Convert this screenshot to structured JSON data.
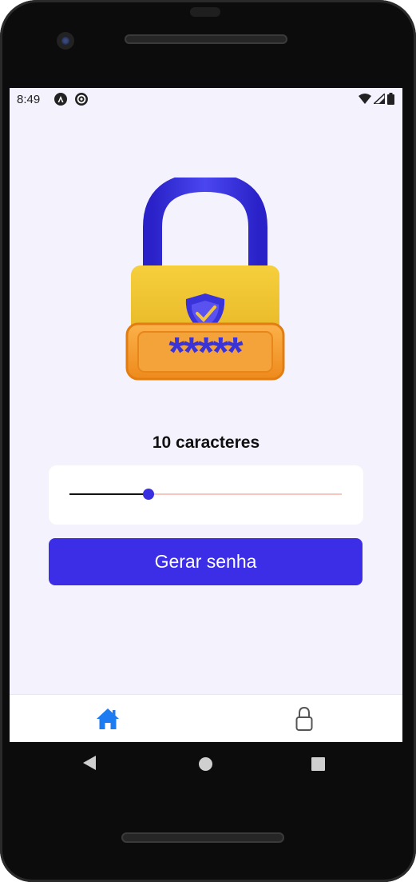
{
  "status_bar": {
    "time": "8:49",
    "icons": [
      "a-circle-icon",
      "at-circle-icon",
      "wifi-icon",
      "signal-icon",
      "battery-icon"
    ]
  },
  "hero": {
    "icon": "padlock-password-icon",
    "password_mask": "*****",
    "colors": {
      "shackle": "#3a33d9",
      "body": "#f2c230",
      "field": "#f39a2a",
      "shield": "#3a33d9"
    }
  },
  "main": {
    "char_label": "10 caracteres",
    "slider": {
      "value": 10,
      "fill_fraction": 0.29
    },
    "generate_button_label": "Gerar senha"
  },
  "tab_bar": {
    "tabs": [
      {
        "icon": "home-icon",
        "active": true,
        "color": "#1e7cf2"
      },
      {
        "icon": "lock-icon",
        "active": false,
        "color": "#555555"
      }
    ]
  },
  "nav_bar": {
    "icons": [
      "back-icon",
      "home-circle-icon",
      "recents-icon"
    ]
  },
  "colors": {
    "accent": "#3b2ee6",
    "screen_bg": "#f3f2fd"
  }
}
